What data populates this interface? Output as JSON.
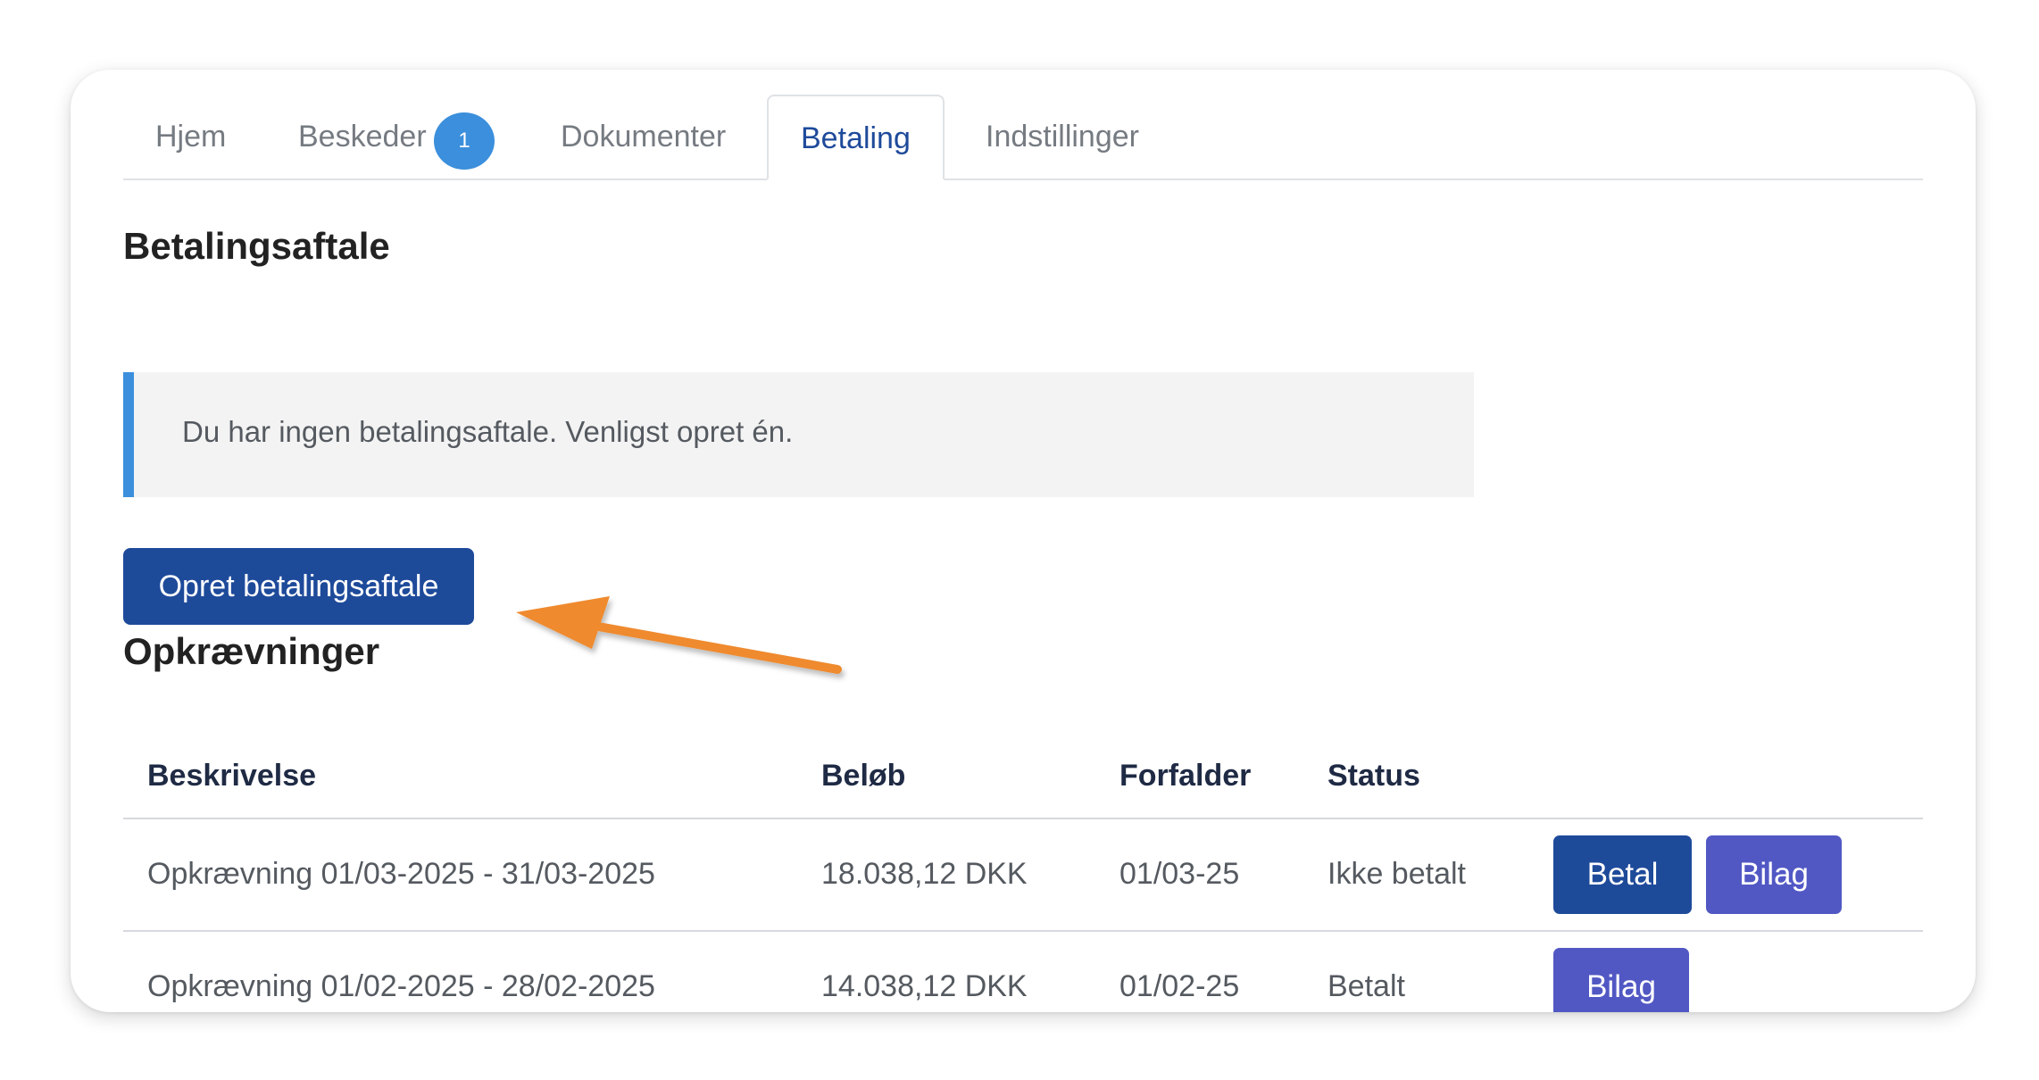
{
  "tabs": [
    {
      "label": "Hjem"
    },
    {
      "label": "Beskeder",
      "badge": "1"
    },
    {
      "label": "Dokumenter"
    },
    {
      "label": "Betaling",
      "active": true
    },
    {
      "label": "Indstillinger"
    }
  ],
  "agreement": {
    "heading": "Betalingsaftale",
    "notice": "Du har ingen betalingsaftale. Venligst opret én.",
    "create_button": "Opret betalingsaftale"
  },
  "charges": {
    "heading": "Opkrævninger",
    "columns": [
      "Beskrivelse",
      "Beløb",
      "Forfalder",
      "Status"
    ],
    "rows": [
      {
        "description": "Opkrævning 01/03-2025 - 31/03-2025",
        "amount": "18.038,12 DKK",
        "due": "01/03-25",
        "status": "Ikke betalt",
        "pay_label": "Betal",
        "voucher_label": "Bilag"
      },
      {
        "description": "Opkrævning 01/02-2025 - 28/02-2025",
        "amount": "14.038,12 DKK",
        "due": "01/02-25",
        "status": "Betalt",
        "voucher_label": "Bilag"
      }
    ]
  },
  "colors": {
    "primary": "#1e4a9a",
    "secondary": "#5158c4",
    "info_accent": "#3b8fdc",
    "annotation_arrow": "#ef8a2f"
  },
  "annotation": {
    "icon": "arrow-pointer-icon"
  }
}
